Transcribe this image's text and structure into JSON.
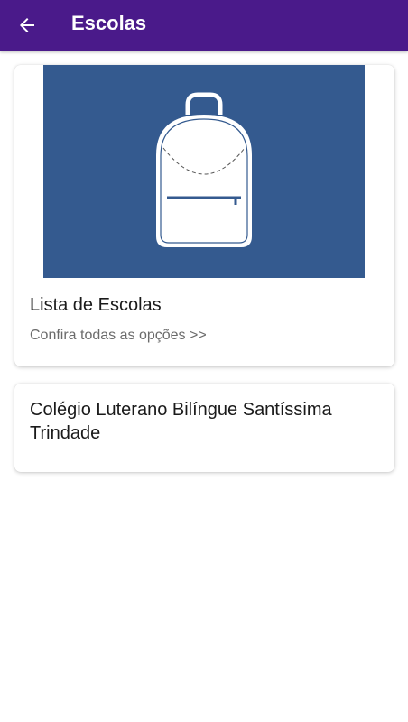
{
  "appbar": {
    "title": "Escolas",
    "back_icon": "arrow-left-icon",
    "background": "#4a1a8a"
  },
  "cards": [
    {
      "image_icon": "backpack-icon",
      "image_background": "#345a8f",
      "title": "Lista de Escolas",
      "subtitle": "Confira todas as opções >>"
    },
    {
      "title": "Colégio Luterano Bilíngue Santíssima Trindade"
    }
  ]
}
